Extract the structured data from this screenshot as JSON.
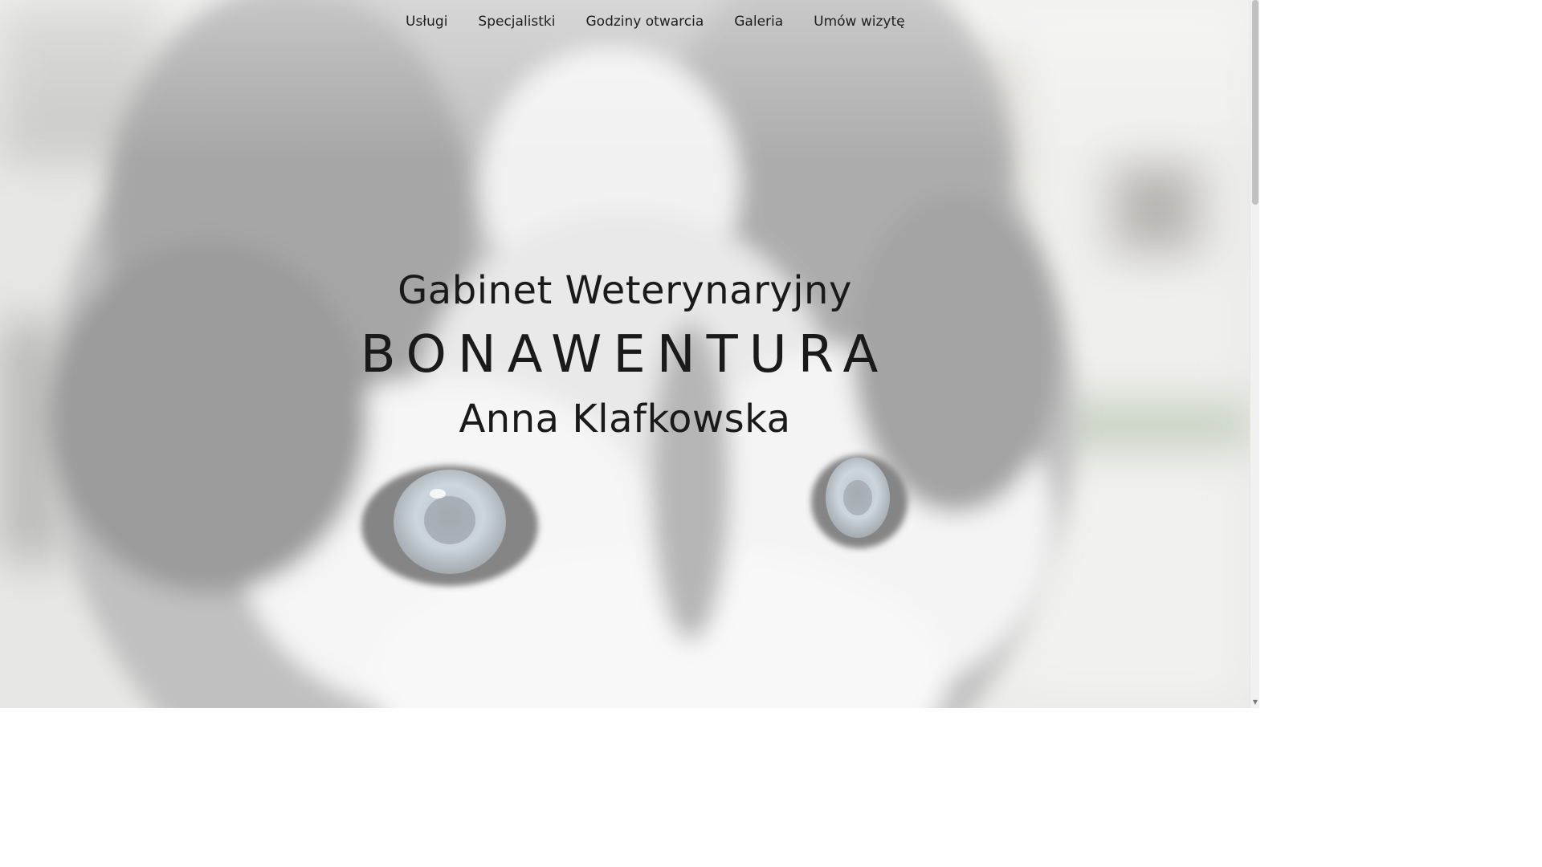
{
  "nav": {
    "items": [
      {
        "label": "Usługi"
      },
      {
        "label": "Specjalistki"
      },
      {
        "label": "Godziny otwarcia"
      },
      {
        "label": "Galeria"
      },
      {
        "label": "Umów wizytę"
      }
    ]
  },
  "hero": {
    "background": "husky-dog-closeup-photo",
    "title_line1": "Gabinet Weterynaryjny",
    "title_line2": "BONAWENTURA",
    "title_line3": "Anna Klafkowska"
  },
  "scrollbar": {
    "down_arrow_icon": "triangle-down-icon"
  },
  "colors": {
    "text": "#1a1a1a",
    "overlay": "#ffffff"
  }
}
